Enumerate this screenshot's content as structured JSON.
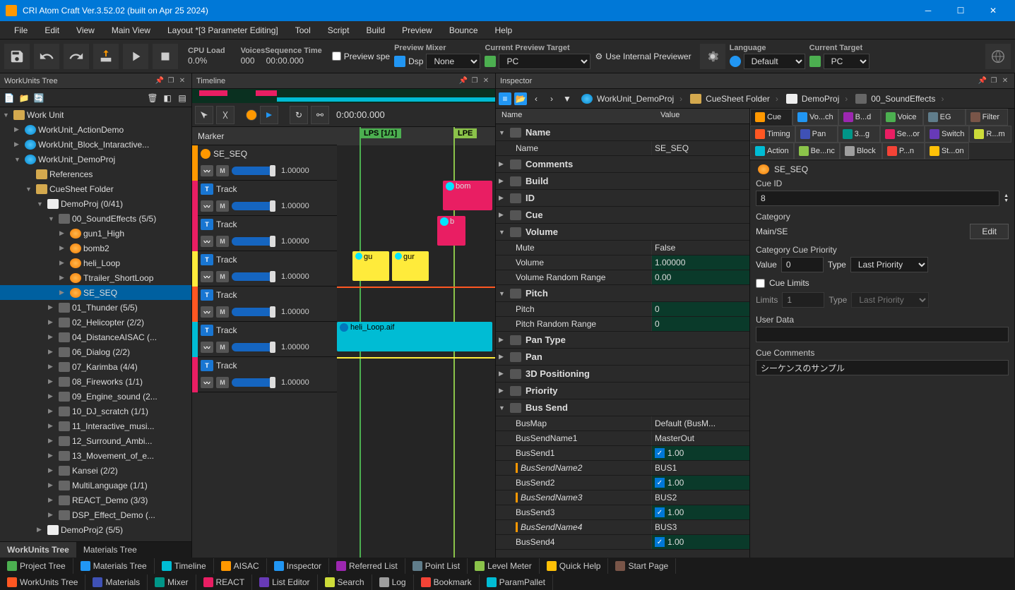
{
  "titlebar": {
    "title": "CRI Atom Craft Ver.3.52.02 (built on Apr 25 2024)"
  },
  "menu": [
    "File",
    "Edit",
    "View",
    "Main View",
    "Layout *[3 Parameter Editing]",
    "Tool",
    "Script",
    "Build",
    "Preview",
    "Bounce",
    "Help"
  ],
  "toolbar": {
    "cpu_load_label": "CPU Load",
    "cpu_load_val": "0.0%",
    "voices_label": "Voices",
    "voices_val": "000",
    "seq_time_label": "Sequence Time",
    "seq_time_val": "00:00.000",
    "preview_spe": "Preview spe",
    "preview_mixer_label": "Preview Mixer",
    "dsp_label": "Dsp",
    "dsp_val": "None",
    "current_target_label": "Current Preview Target",
    "target_val": "PC",
    "use_internal": "Use Internal Previewer",
    "language_label": "Language",
    "language_val": "Default",
    "curr_target2_label": "Current Target",
    "curr_target2_val": "PC"
  },
  "work_tree": {
    "panel_title": "WorkUnits Tree",
    "root": "Work Unit",
    "items": [
      {
        "label": "WorkUnit_ActionDemo",
        "depth": 1,
        "arrow": "▶",
        "icon": "wu"
      },
      {
        "label": "WorkUnit_Block_Intaractive...",
        "depth": 1,
        "arrow": "▶",
        "icon": "wu"
      },
      {
        "label": "WorkUnit_DemoProj",
        "depth": 1,
        "arrow": "▼",
        "icon": "wu"
      },
      {
        "label": "References",
        "depth": 2,
        "arrow": "",
        "icon": "folder"
      },
      {
        "label": "CueSheet Folder",
        "depth": 2,
        "arrow": "▼",
        "icon": "folder"
      },
      {
        "label": "DemoProj (0/41)",
        "depth": 3,
        "arrow": "▼",
        "icon": "sheet"
      },
      {
        "label": "00_SoundEffects (5/5)",
        "depth": 4,
        "arrow": "▼",
        "icon": "folder-g"
      },
      {
        "label": "gun1_High",
        "depth": 5,
        "arrow": "▶",
        "icon": "cue"
      },
      {
        "label": "bomb2",
        "depth": 5,
        "arrow": "▶",
        "icon": "cue"
      },
      {
        "label": "heli_Loop",
        "depth": 5,
        "arrow": "▶",
        "icon": "cue"
      },
      {
        "label": "Ttrailer_ShortLoop",
        "depth": 5,
        "arrow": "▶",
        "icon": "cue"
      },
      {
        "label": "SE_SEQ",
        "depth": 5,
        "arrow": "▶",
        "icon": "cue",
        "selected": true
      },
      {
        "label": "01_Thunder (5/5)",
        "depth": 4,
        "arrow": "▶",
        "icon": "folder-g"
      },
      {
        "label": "02_Helicopter (2/2)",
        "depth": 4,
        "arrow": "▶",
        "icon": "folder-g"
      },
      {
        "label": "04_DistanceAISAC (...",
        "depth": 4,
        "arrow": "▶",
        "icon": "folder-g"
      },
      {
        "label": "06_Dialog (2/2)",
        "depth": 4,
        "arrow": "▶",
        "icon": "folder-g"
      },
      {
        "label": "07_Karimba (4/4)",
        "depth": 4,
        "arrow": "▶",
        "icon": "folder-g"
      },
      {
        "label": "08_Fireworks (1/1)",
        "depth": 4,
        "arrow": "▶",
        "icon": "folder-g"
      },
      {
        "label": "09_Engine_sound (2...",
        "depth": 4,
        "arrow": "▶",
        "icon": "folder-g"
      },
      {
        "label": "10_DJ_scratch (1/1)",
        "depth": 4,
        "arrow": "▶",
        "icon": "folder-g"
      },
      {
        "label": "11_Interactive_musi...",
        "depth": 4,
        "arrow": "▶",
        "icon": "folder-g"
      },
      {
        "label": "12_Surround_Ambi...",
        "depth": 4,
        "arrow": "▶",
        "icon": "folder-g"
      },
      {
        "label": "13_Movement_of_e...",
        "depth": 4,
        "arrow": "▶",
        "icon": "folder-g"
      },
      {
        "label": "Kansei (2/2)",
        "depth": 4,
        "arrow": "▶",
        "icon": "folder-g"
      },
      {
        "label": "MultiLanguage (1/1)",
        "depth": 4,
        "arrow": "▶",
        "icon": "folder-g"
      },
      {
        "label": "REACT_Demo (3/3)",
        "depth": 4,
        "arrow": "▶",
        "icon": "folder-g"
      },
      {
        "label": "DSP_Effect_Demo (...",
        "depth": 4,
        "arrow": "▶",
        "icon": "folder-g"
      },
      {
        "label": "DemoProj2 (5/5)",
        "depth": 3,
        "arrow": "▶",
        "icon": "sheet"
      }
    ],
    "tabs": [
      "WorkUnits Tree",
      "Materials Tree"
    ]
  },
  "timeline": {
    "panel_title": "Timeline",
    "time": "0:00:00.000",
    "marker_label": "Marker",
    "lps": "LPS [1/1]",
    "lpe": "LPE",
    "seq_name": "SE_SEQ",
    "tracks": [
      {
        "name": "Track",
        "color": "#e91e63",
        "val": "1.00000"
      },
      {
        "name": "Track",
        "color": "#e91e63",
        "val": "1.00000"
      },
      {
        "name": "Track",
        "color": "#ffeb3b",
        "val": "1.00000"
      },
      {
        "name": "Track",
        "color": "#ff5722",
        "val": "1.00000"
      },
      {
        "name": "Track",
        "color": "#00bcd4",
        "val": "1.00000"
      },
      {
        "name": "Track",
        "color": "#e91e63",
        "val": "1.00000"
      }
    ],
    "clips": {
      "bom": "bom",
      "b": "b",
      "gu1": "gu",
      "gu2": "gur",
      "heli": "heli_Loop.aif"
    }
  },
  "inspector": {
    "panel_title": "Inspector",
    "breadcrumb": [
      "WorkUnit_DemoProj",
      "CueSheet Folder",
      "DemoProj",
      "00_SoundEffects"
    ],
    "col_name": "Name",
    "col_value": "Value",
    "groups": [
      {
        "label": "Name",
        "open": true,
        "props": [
          {
            "name": "Name",
            "value": "SE_SEQ"
          }
        ]
      },
      {
        "label": "Comments",
        "open": false
      },
      {
        "label": "Build",
        "open": false
      },
      {
        "label": "ID",
        "open": false
      },
      {
        "label": "Cue",
        "open": false
      },
      {
        "label": "Volume",
        "open": true,
        "props": [
          {
            "name": "Mute",
            "value": "False"
          },
          {
            "name": "Volume",
            "value": "1.00000",
            "edit": true
          },
          {
            "name": "Volume Random Range",
            "value": "0.00",
            "edit": true
          }
        ]
      },
      {
        "label": "Pitch",
        "open": true,
        "props": [
          {
            "name": "Pitch",
            "value": "0",
            "edit": true
          },
          {
            "name": "Pitch Random Range",
            "value": "0",
            "edit": true
          }
        ]
      },
      {
        "label": "Pan Type",
        "open": false
      },
      {
        "label": "Pan",
        "open": false
      },
      {
        "label": "3D Positioning",
        "open": false
      },
      {
        "label": "Priority",
        "open": false
      },
      {
        "label": "Bus Send",
        "open": true,
        "props": [
          {
            "name": "BusMap",
            "value": "Default (BusM..."
          },
          {
            "name": "BusSendName1",
            "value": "MasterOut"
          },
          {
            "name": "BusSend1",
            "value": "1.00",
            "check": true
          },
          {
            "name": "BusSendName2",
            "value": "BUS1",
            "italic": true
          },
          {
            "name": "BusSend2",
            "value": "1.00",
            "check": true
          },
          {
            "name": "BusSendName3",
            "value": "BUS2",
            "italic": true
          },
          {
            "name": "BusSend3",
            "value": "1.00",
            "check": true
          },
          {
            "name": "BusSendName4",
            "value": "BUS3",
            "italic": true
          },
          {
            "name": "BusSend4",
            "value": "1.00",
            "check": true
          }
        ]
      }
    ],
    "right_tabs": [
      {
        "label": "Cue",
        "color": "#ff9800",
        "active": true
      },
      {
        "label": "Vo...ch",
        "color": "#2196f3"
      },
      {
        "label": "B...d",
        "color": "#9c27b0"
      },
      {
        "label": "Voice",
        "color": "#4caf50"
      },
      {
        "label": "EG",
        "color": "#607d8b"
      },
      {
        "label": "Filter",
        "color": "#795548"
      },
      {
        "label": "Timing",
        "color": "#ff5722"
      },
      {
        "label": "Pan",
        "color": "#3f51b5"
      },
      {
        "label": "3...g",
        "color": "#009688"
      },
      {
        "label": "Se...or",
        "color": "#e91e63"
      },
      {
        "label": "Switch",
        "color": "#673ab7"
      },
      {
        "label": "R...m",
        "color": "#cddc39"
      },
      {
        "label": "Action",
        "color": "#00bcd4"
      },
      {
        "label": "Be...nc",
        "color": "#8bc34a"
      },
      {
        "label": "Block",
        "color": "#9e9e9e"
      },
      {
        "label": "P...n",
        "color": "#f44336"
      },
      {
        "label": "St...on",
        "color": "#ffc107"
      }
    ],
    "cue_pane": {
      "name": "SE_SEQ",
      "cue_id_label": "Cue ID",
      "cue_id": "8",
      "category_label": "Category",
      "category_val": "Main/SE",
      "edit_btn": "Edit",
      "cat_prio_label": "Category Cue Priority",
      "value_label": "Value",
      "value_val": "0",
      "type_label": "Type",
      "type_val": "Last Priority",
      "cue_limits_label": "Cue Limits",
      "limits_label": "Limits",
      "limits_val": "1",
      "type2_label": "Type",
      "type2_val": "Last Priority",
      "user_data_label": "User Data",
      "comments_label": "Cue Comments",
      "comments_val": "シーケンスのサンプル"
    }
  },
  "bottom_dock": {
    "row1": [
      "Project Tree",
      "Materials Tree",
      "Timeline",
      "AISAC",
      "Inspector",
      "Referred List",
      "Point List",
      "Level Meter",
      "Quick Help",
      "Start Page"
    ],
    "row2": [
      "WorkUnits Tree",
      "Materials",
      "Mixer",
      "REACT",
      "List Editor",
      "Search",
      "Log",
      "Bookmark",
      "ParamPallet"
    ]
  }
}
